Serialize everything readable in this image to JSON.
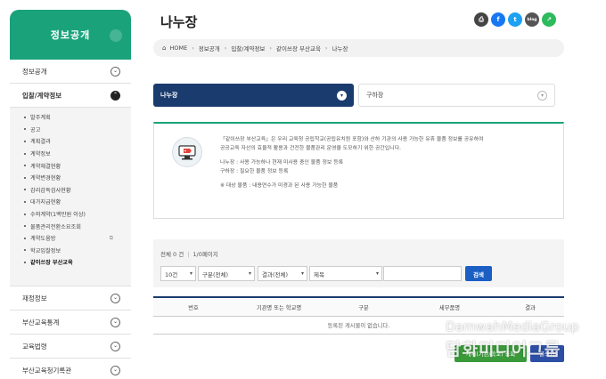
{
  "sidebar": {
    "title": "정보공개",
    "sections_top": [
      {
        "label": "정보공개",
        "state": "collapsed"
      },
      {
        "label": "입찰/계약정보",
        "state": "expanded"
      }
    ],
    "sub_items": [
      {
        "label": "발주계획"
      },
      {
        "label": "공고"
      },
      {
        "label": "계획결과"
      },
      {
        "label": "계약정보"
      },
      {
        "label": "계약체결현황"
      },
      {
        "label": "계약변경현황"
      },
      {
        "label": "감리감독검사현황"
      },
      {
        "label": "대가지급현황"
      },
      {
        "label": "수의계약(1백만원 이상)"
      },
      {
        "label": "물품관리전환소요조회"
      },
      {
        "label": "계약도움방"
      },
      {
        "label": "학교입찰정보"
      },
      {
        "label": "같이쓰장 부산교육"
      }
    ],
    "sections_bottom": [
      {
        "label": "재정정보"
      },
      {
        "label": "부산교육통계"
      },
      {
        "label": "교육법령"
      },
      {
        "label": "부산교육청기록관"
      }
    ]
  },
  "header": {
    "title": "나누장",
    "share_icons": [
      {
        "name": "print-icon",
        "glyph": "⎙",
        "color": "#444444"
      },
      {
        "name": "facebook-icon",
        "glyph": "f",
        "color": "#1877f2"
      },
      {
        "name": "twitter-icon",
        "glyph": "t",
        "color": "#1da1f2"
      },
      {
        "name": "blog-icon",
        "glyph": "blog",
        "color": "#555555"
      },
      {
        "name": "share-icon",
        "glyph": "↗",
        "color": "#2dbb5d"
      }
    ]
  },
  "breadcrumb": [
    "HOME",
    "정보공개",
    "입찰/계약정보",
    "같이쓰장 부산교육",
    "나누장"
  ],
  "tabs": {
    "active": "나누장",
    "other": "구하장"
  },
  "info": {
    "lines": [
      "「같이쓰장 부산교육」은 우리 교육청 공립학교(공립유치원 포함)와 산하 기관의 사용 가능한 유휴 물품 정보를 공유하여",
      "공공교육 자산의 효율적 활용과 건전한 물품관리 운영을 도모하기 위한 공간입니다."
    ],
    "defs": [
      "나누장 : 사용 가능하나 현재 미사용 중인 물품 정보 등록",
      "구하장 : 필요한 물품 정보 등록"
    ],
    "note": "※ 대상 물품 : 내용연수가 미경과 된 사용 가능한 물품"
  },
  "search": {
    "total_label": "전체 0 건",
    "page_label": "1/0페이지",
    "page_size": "10건",
    "category": "구분(전체)",
    "result": "결과(전체)",
    "field": "제목",
    "query": "",
    "button": "검색"
  },
  "table": {
    "headers": [
      "번호",
      "기관명 또는 학교명",
      "구분",
      "세부품명",
      "결과"
    ],
    "empty_message": "등록된 게시물이 없습니다."
  },
  "buttons": {
    "my_list": "게시(기관/학교) 조회",
    "write": "글쓰기"
  },
  "watermark": {
    "line1": "DamwahMediaGroup",
    "line2": "담화미디어그룹"
  },
  "colors": {
    "sidebar_green": "#1aa37b",
    "navy": "#1a3b6e",
    "search_blue": "#1b5fc4",
    "button_green": "#3a9a3a",
    "button_blue": "#2c4fa5"
  }
}
